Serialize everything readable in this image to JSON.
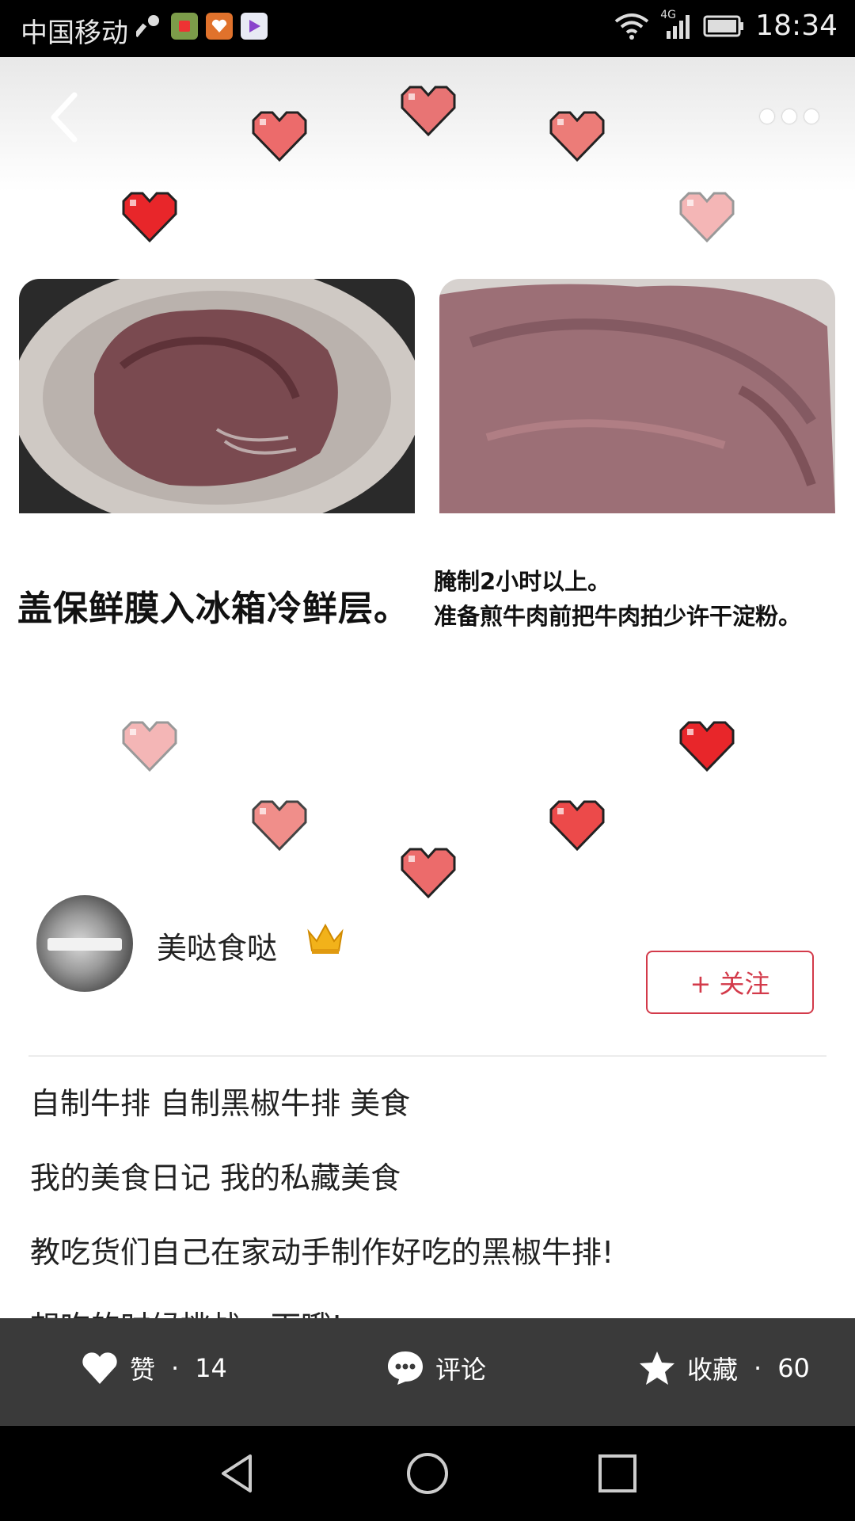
{
  "status_bar": {
    "carrier": "中国移动",
    "time": "18:34",
    "network": "4G"
  },
  "header": {
    "back_icon": "chevron-left-icon",
    "more_icon": "more-horizontal-icon"
  },
  "post": {
    "caption_left": "盖保鲜膜入冰箱冷鲜层。",
    "caption_right_line1": "腌制2小时以上。",
    "caption_right_line2": "准备煎牛肉前把牛肉拍少许干淀粉。"
  },
  "author": {
    "name": "美哒食哒",
    "follow_label": "+ 关注"
  },
  "content": {
    "line1": "自制牛排 自制黑椒牛排 美食",
    "line2": "我的美食日记 我的私藏美食",
    "line3": "教吃货们自己在家动手制作好吃的黑椒牛排!",
    "line4": "想吃的时候挑战一下哦!"
  },
  "actions": {
    "like_label": "赞",
    "like_sep": "·",
    "like_count": "14",
    "comment_label": "评论",
    "fav_label": "收藏",
    "fav_sep": "·",
    "fav_count": "60"
  },
  "colors": {
    "accent": "#d33a4a",
    "action_bar": "#3a3a3a"
  }
}
